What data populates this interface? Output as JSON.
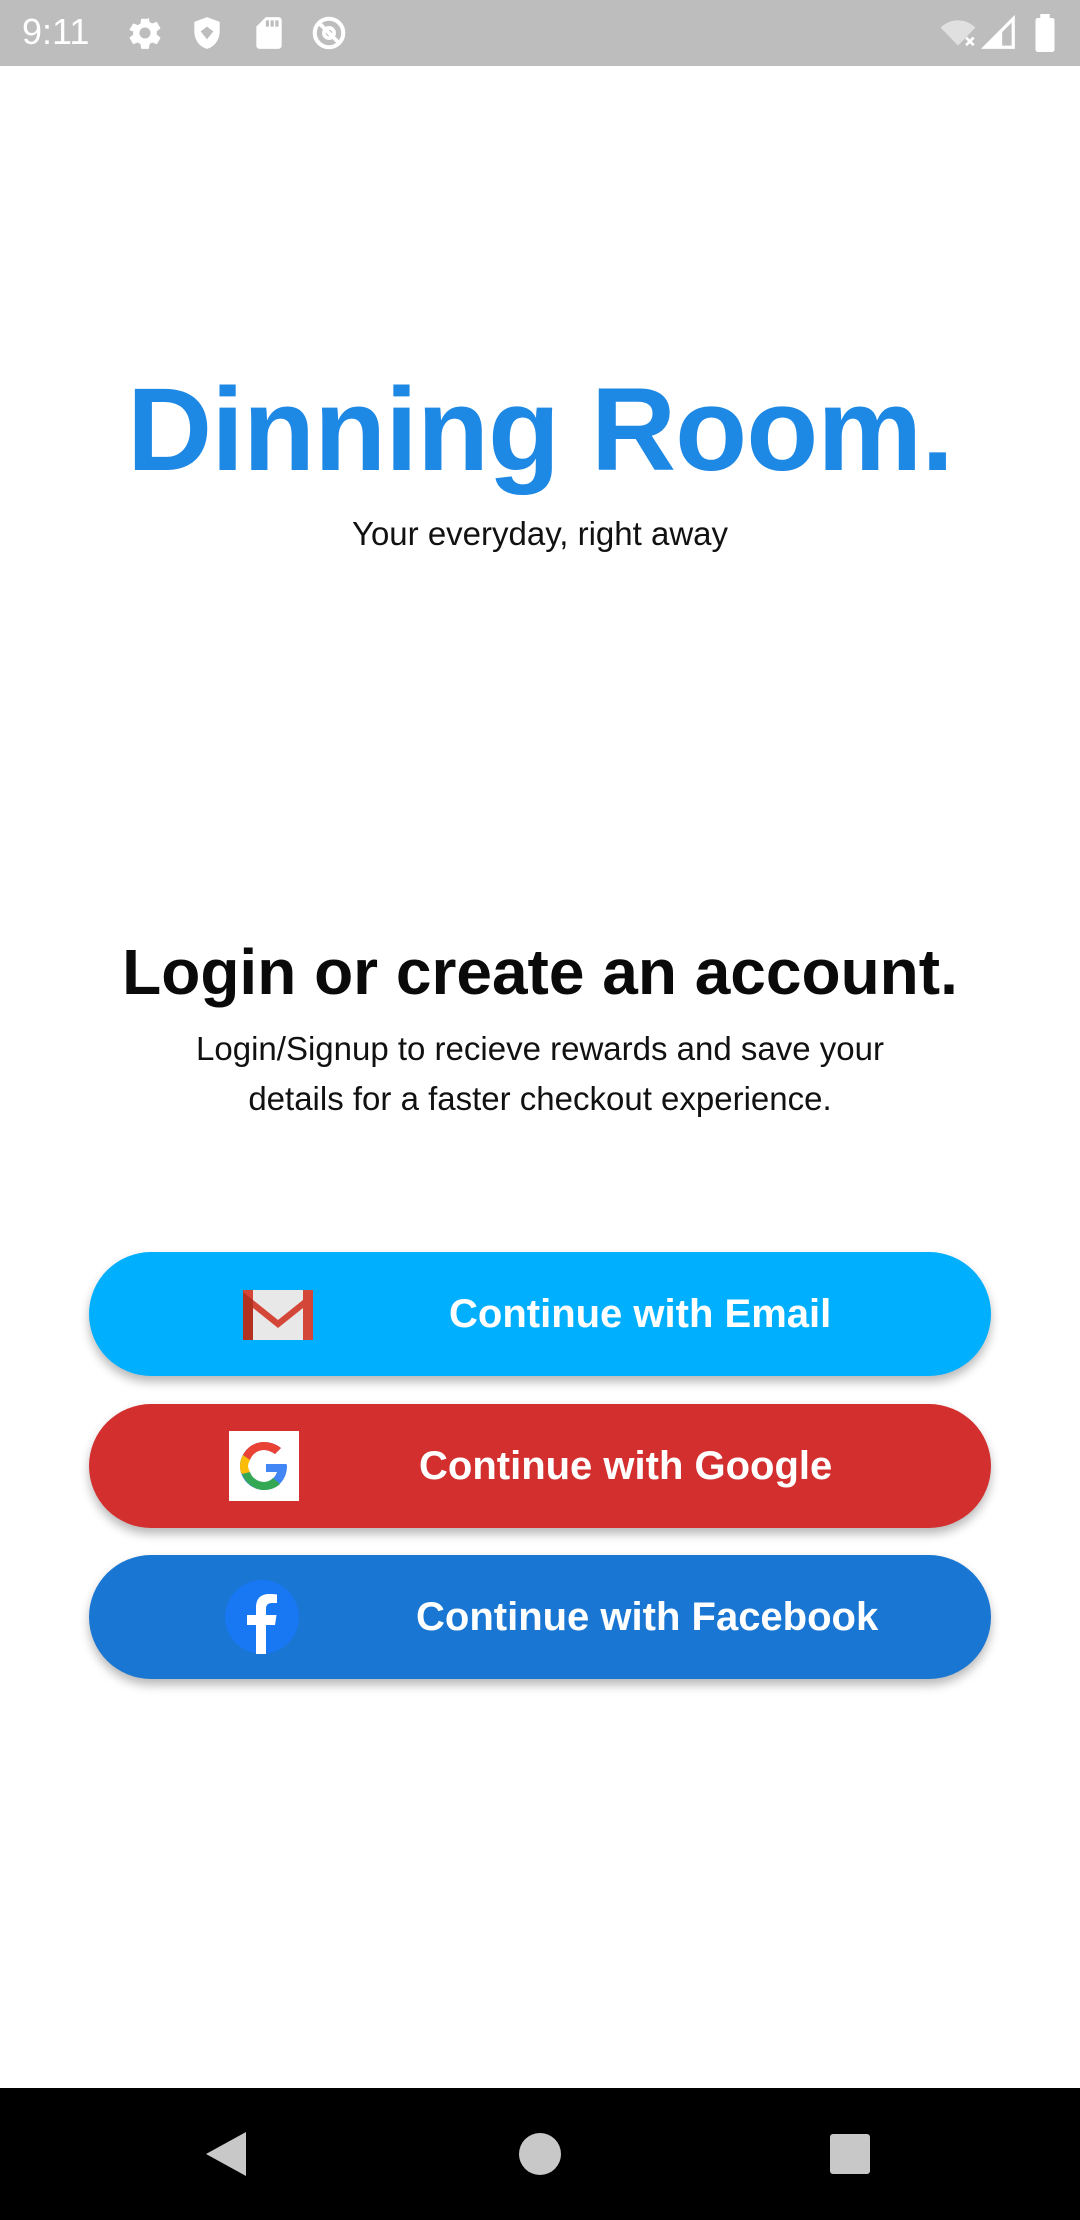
{
  "status_bar": {
    "time": "9:11",
    "icons_left": [
      "gear-icon",
      "shield-icon",
      "sd-card-icon",
      "at-sign-icon"
    ],
    "icons_right": [
      "wifi-off-icon",
      "signal-icon",
      "battery-icon"
    ]
  },
  "brand": {
    "title": "Dinning Room.",
    "tagline": "Your everyday, right away",
    "color": "#1e88e5"
  },
  "login": {
    "heading": "Login or create an account.",
    "subtitle_line1": "Login/Signup to recieve rewards and save your",
    "subtitle_line2": "details for a faster checkout experience."
  },
  "buttons": {
    "email": {
      "label": "Continue with Email",
      "icon": "gmail-icon",
      "color": "#00b0ff"
    },
    "google": {
      "label": "Continue with Google",
      "icon": "google-icon",
      "color": "#d32f2f"
    },
    "facebook": {
      "label": "Continue with Facebook",
      "icon": "facebook-icon",
      "color": "#1976d2"
    }
  },
  "nav_bar": {
    "buttons": [
      "back-icon",
      "home-icon",
      "recents-icon"
    ]
  }
}
